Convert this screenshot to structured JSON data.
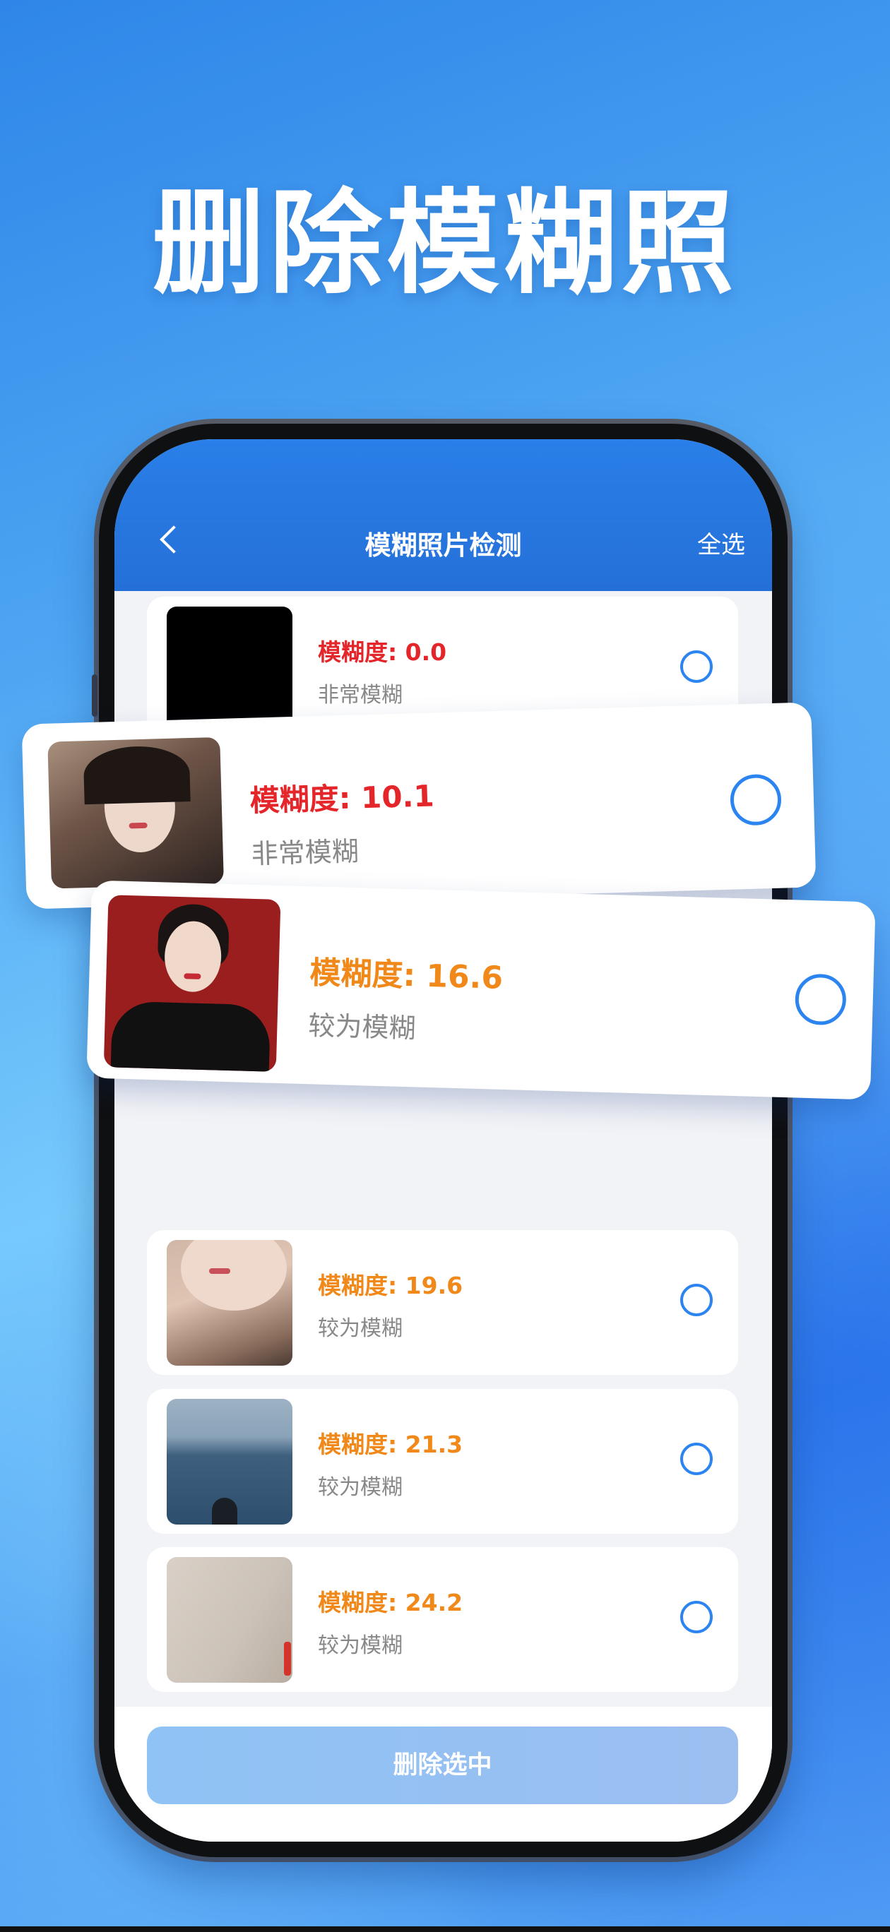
{
  "hero": {
    "title": "删除模糊照"
  },
  "nav": {
    "back_icon": "chevron-left-icon",
    "title": "模糊照片检测",
    "select_all": "全选"
  },
  "items": [
    {
      "score": "模糊度: 0.0",
      "level": "非常模糊",
      "color": "#e4262a",
      "thumb": "black"
    },
    {
      "score": "模糊度: 10.1",
      "level": "非常模糊",
      "color": "#e4262a",
      "thumb": "portrait-dark-hair"
    },
    {
      "score": "模糊度: 16.6",
      "level": "较为模糊",
      "color": "#f0891a",
      "thumb": "portrait-red-background"
    },
    {
      "score": "模糊度: 19.6",
      "level": "较为模糊",
      "color": "#f0891a",
      "thumb": "portrait-closeup"
    },
    {
      "score": "模糊度: 21.3",
      "level": "较为模糊",
      "color": "#f0891a",
      "thumb": "sea"
    },
    {
      "score": "模糊度: 24.2",
      "level": "较为模糊",
      "color": "#f0891a",
      "thumb": "beige-surface"
    }
  ],
  "bottom": {
    "delete_label": "删除选中"
  },
  "colors": {
    "accent": "#2b84ef",
    "nav_bg": "#2a7fe8",
    "very_blurry": "#e4262a",
    "somewhat_blurry": "#f0891a"
  }
}
